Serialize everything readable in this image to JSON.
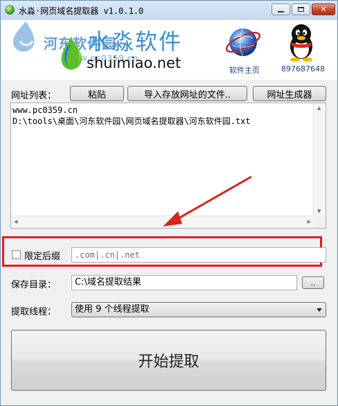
{
  "window": {
    "title": "水淼·网页域名提取器 v1.0.1.0"
  },
  "banner": {
    "brand_cn": "水淼软件",
    "brand_en": "shuimiao.net",
    "home_label": "软件主页",
    "qq_label": "897687648",
    "watermark_text": "河东软件园",
    "watermark_url": "www.pc0359.cn"
  },
  "url_list": {
    "label": "网址列表：",
    "paste_button": "粘贴",
    "import_button": "导入存放网址的文件..",
    "generator_button": "网址生成器",
    "content_lines": [
      "www.pc0359.cn",
      "D:\\tools\\桌面\\河东软件园\\网页域名提取器\\河东软件园.txt"
    ]
  },
  "suffix": {
    "checkbox_label": "限定后缀",
    "checked": false,
    "value": ".com|.cn|.net"
  },
  "save_dir": {
    "label": "保存目录：",
    "value": "C:\\域名提取结果",
    "browse_button": ".."
  },
  "threads": {
    "label": "提取线程：",
    "selected": "使用 9 个线程提取"
  },
  "start_button": "开始提取",
  "icons": {
    "app": "app-icon",
    "home": "globe-icon",
    "qq": "qq-penguin-icon",
    "annotation": "red-arrow-icon"
  },
  "colors": {
    "highlight": "#e51c23",
    "brand_blue": "#3a8fd8"
  }
}
